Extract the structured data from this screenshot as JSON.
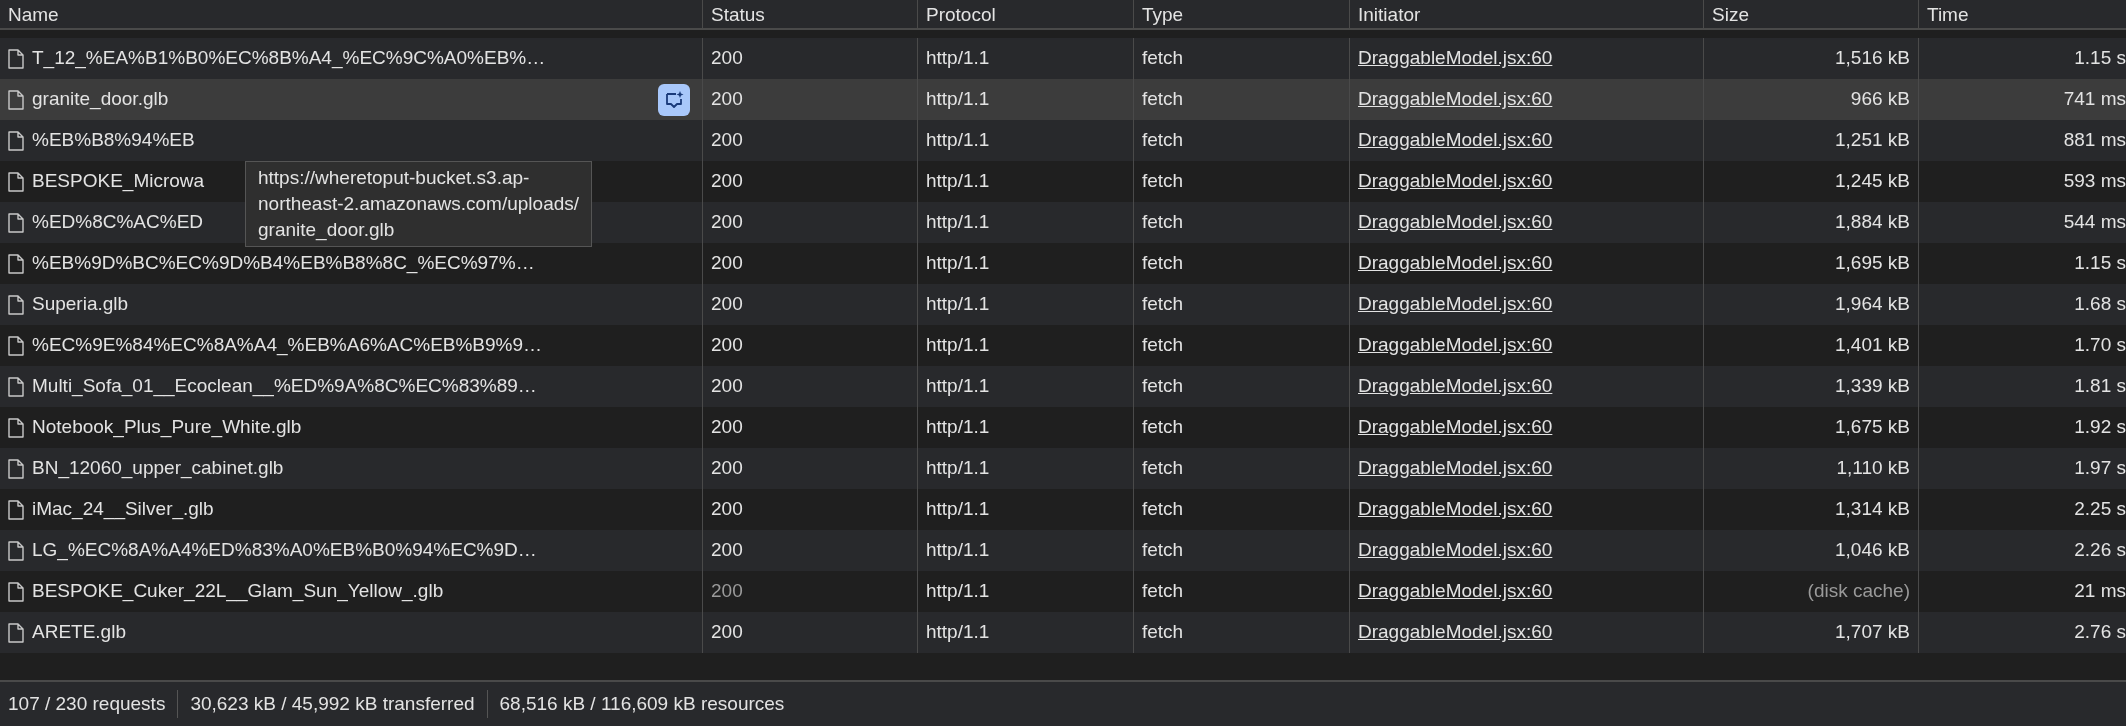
{
  "columns": [
    {
      "label": "Name"
    },
    {
      "label": "Status"
    },
    {
      "label": "Protocol"
    },
    {
      "label": "Type"
    },
    {
      "label": "Initiator"
    },
    {
      "label": "Size"
    },
    {
      "label": "Time"
    }
  ],
  "rows": [
    {
      "name": "T_12_%EA%B1%B0%EC%8B%A4_%EC%9C%A0%EB%…",
      "status": "200",
      "protocol": "http/1.1",
      "type": "fetch",
      "initiator": "DraggableModel.jsx:60",
      "size": "1,516 kB",
      "time": "1.15 s",
      "hovered": false,
      "cached": false
    },
    {
      "name": "granite_door.glb",
      "status": "200",
      "protocol": "http/1.1",
      "type": "fetch",
      "initiator": "DraggableModel.jsx:60",
      "size": "966 kB",
      "time": "741 ms",
      "hovered": true,
      "cached": false
    },
    {
      "name": "%EB%B8%94%EB",
      "status": "200",
      "protocol": "http/1.1",
      "type": "fetch",
      "initiator": "DraggableModel.jsx:60",
      "size": "1,251 kB",
      "time": "881 ms",
      "hovered": false,
      "cached": false
    },
    {
      "name": "BESPOKE_Microwa",
      "status": "200",
      "protocol": "http/1.1",
      "type": "fetch",
      "initiator": "DraggableModel.jsx:60",
      "size": "1,245 kB",
      "time": "593 ms",
      "hovered": false,
      "cached": false
    },
    {
      "name": "%ED%8C%AC%ED",
      "status": "200",
      "protocol": "http/1.1",
      "type": "fetch",
      "initiator": "DraggableModel.jsx:60",
      "size": "1,884 kB",
      "time": "544 ms",
      "hovered": false,
      "cached": false
    },
    {
      "name": "%EB%9D%BC%EC%9D%B4%EB%B8%8C_%EC%97%…",
      "status": "200",
      "protocol": "http/1.1",
      "type": "fetch",
      "initiator": "DraggableModel.jsx:60",
      "size": "1,695 kB",
      "time": "1.15 s",
      "hovered": false,
      "cached": false
    },
    {
      "name": "Superia.glb",
      "status": "200",
      "protocol": "http/1.1",
      "type": "fetch",
      "initiator": "DraggableModel.jsx:60",
      "size": "1,964 kB",
      "time": "1.68 s",
      "hovered": false,
      "cached": false
    },
    {
      "name": "%EC%9E%84%EC%8A%A4_%EB%A6%AC%EB%B9%9…",
      "status": "200",
      "protocol": "http/1.1",
      "type": "fetch",
      "initiator": "DraggableModel.jsx:60",
      "size": "1,401 kB",
      "time": "1.70 s",
      "hovered": false,
      "cached": false
    },
    {
      "name": "Multi_Sofa_01__Ecoclean__%ED%9A%8C%EC%83%89…",
      "status": "200",
      "protocol": "http/1.1",
      "type": "fetch",
      "initiator": "DraggableModel.jsx:60",
      "size": "1,339 kB",
      "time": "1.81 s",
      "hovered": false,
      "cached": false
    },
    {
      "name": "Notebook_Plus_Pure_White.glb",
      "status": "200",
      "protocol": "http/1.1",
      "type": "fetch",
      "initiator": "DraggableModel.jsx:60",
      "size": "1,675 kB",
      "time": "1.92 s",
      "hovered": false,
      "cached": false
    },
    {
      "name": "BN_12060_upper_cabinet.glb",
      "status": "200",
      "protocol": "http/1.1",
      "type": "fetch",
      "initiator": "DraggableModel.jsx:60",
      "size": "1,110 kB",
      "time": "1.97 s",
      "hovered": false,
      "cached": false
    },
    {
      "name": "iMac_24__Silver_.glb",
      "status": "200",
      "protocol": "http/1.1",
      "type": "fetch",
      "initiator": "DraggableModel.jsx:60",
      "size": "1,314 kB",
      "time": "2.25 s",
      "hovered": false,
      "cached": false
    },
    {
      "name": "LG_%EC%8A%A4%ED%83%A0%EB%B0%94%EC%9D…",
      "status": "200",
      "protocol": "http/1.1",
      "type": "fetch",
      "initiator": "DraggableModel.jsx:60",
      "size": "1,046 kB",
      "time": "2.26 s",
      "hovered": false,
      "cached": false
    },
    {
      "name": "BESPOKE_Cuker_22L__Glam_Sun_Yellow_.glb",
      "status": "200",
      "protocol": "http/1.1",
      "type": "fetch",
      "initiator": "DraggableModel.jsx:60",
      "size": "(disk cache)",
      "time": "21 ms",
      "hovered": false,
      "cached": true
    },
    {
      "name": "ARETE.glb",
      "status": "200",
      "protocol": "http/1.1",
      "type": "fetch",
      "initiator": "DraggableModel.jsx:60",
      "size": "1,707 kB",
      "time": "2.76 s",
      "hovered": false,
      "cached": false
    }
  ],
  "tooltip": {
    "lines": [
      "https://wheretoput-bucket.s3.ap-",
      "northeast-2.amazonaws.com/uploads/",
      "granite_door.glb"
    ]
  },
  "status_bar": [
    "107 / 230 requests",
    "30,623 kB / 45,992 kB transferred",
    "68,516 kB / 116,609 kB resources"
  ]
}
